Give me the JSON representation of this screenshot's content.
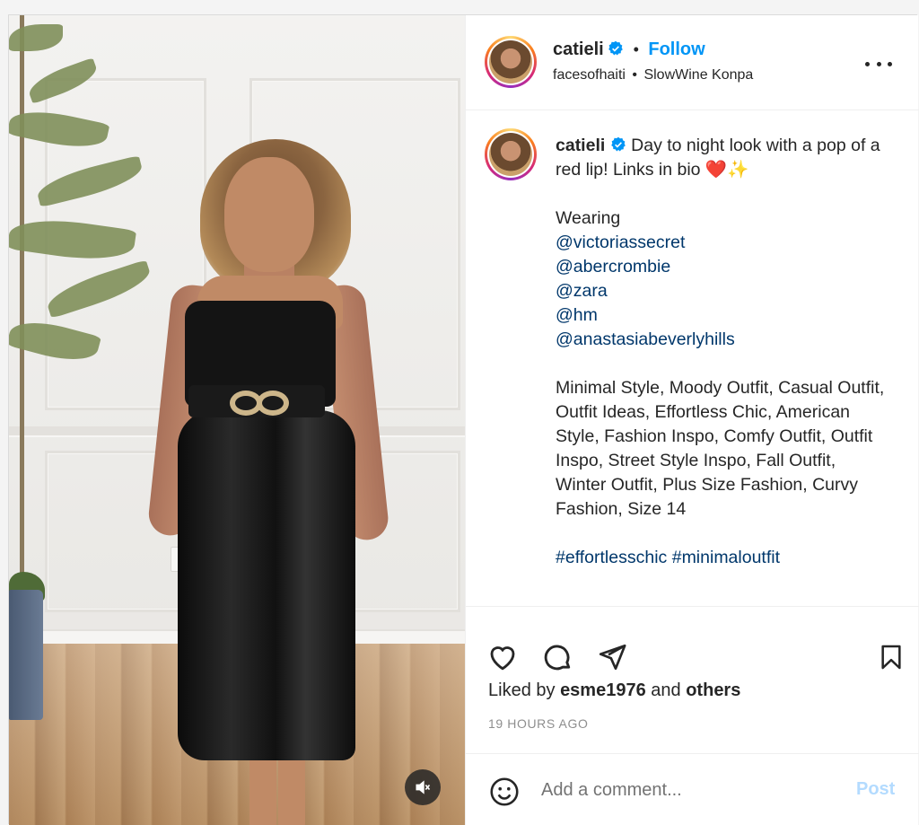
{
  "header": {
    "username": "catieli",
    "follow_label": "Follow",
    "separator": "•",
    "subtitle_account": "facesofhaiti",
    "subtitle_sep": "•",
    "subtitle_audio": "SlowWine Konpa"
  },
  "caption": {
    "username": "catieli",
    "line1": "Day to night look with a pop of a red lip! Links in bio ❤️✨",
    "wearing": "Wearing",
    "tags": [
      "@victoriassecret",
      "@abercrombie",
      "@zara",
      "@hm",
      "@anastasiabeverlyhills"
    ],
    "keywords": "Minimal Style, Moody Outfit, Casual Outfit, Outfit Ideas, Effortless Chic, American Style, Fashion Inspo, Comfy Outfit, Outfit Inspo, Street Style Inspo, Fall Outfit, Winter Outfit, Plus Size Fashion, Curvy Fashion, Size 14",
    "hashtags": [
      "#effortlesschic",
      "#minimaloutfit"
    ]
  },
  "likes": {
    "prefix": "Liked by",
    "user": "esme1976",
    "middle": "and",
    "others": "others"
  },
  "timestamp": "19 HOURS AGO",
  "comment": {
    "placeholder": "Add a comment...",
    "post_label": "Post"
  },
  "icons": {
    "header_more": "more-horizontal-icon",
    "verified": "verified-badge-icon",
    "like": "heart-icon",
    "comment": "comment-bubble-icon",
    "share": "paper-plane-icon",
    "save": "bookmark-icon",
    "emoji": "emoji-smile-icon",
    "mute": "speaker-muted-icon"
  },
  "colors": {
    "link": "#00376b",
    "follow": "#0095f6",
    "post_disabled": "#b3dbff",
    "muted_text": "#8e8e8e"
  }
}
